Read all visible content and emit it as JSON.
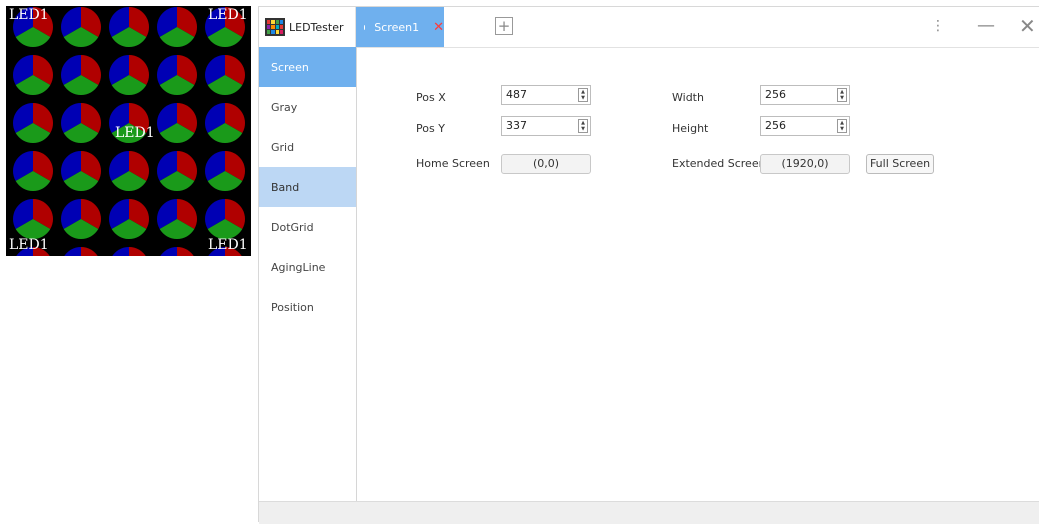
{
  "preview": {
    "labels": [
      "LED1",
      "LED1",
      "LED1",
      "LED1",
      "LED1"
    ],
    "colors": {
      "red": "#b00000",
      "blue": "#0000b4",
      "green": "#1a9a1a",
      "background": "#000000"
    }
  },
  "app": {
    "title": "LEDTester",
    "logo_icon": "led-grid-logo-icon",
    "tabs": [
      {
        "label": "Screen1",
        "close_icon": "close-icon"
      }
    ],
    "add_tab_icon": "plus-icon",
    "window_controls": {
      "more": "more-vertical-icon",
      "minimize": "minimize-icon",
      "close": "close-icon"
    }
  },
  "sidebar": {
    "items": [
      {
        "label": "Screen"
      },
      {
        "label": "Gray"
      },
      {
        "label": "Grid"
      },
      {
        "label": "Band"
      },
      {
        "label": "DotGrid"
      },
      {
        "label": "AgingLine"
      },
      {
        "label": "Position"
      }
    ]
  },
  "form": {
    "pos_x": {
      "label": "Pos X",
      "value": "487"
    },
    "pos_y": {
      "label": "Pos Y",
      "value": "337"
    },
    "width": {
      "label": "Width",
      "value": "256"
    },
    "height": {
      "label": "Height",
      "value": "256"
    },
    "home_screen": {
      "label": "Home Screen",
      "value": "(0,0)"
    },
    "extended_screen": {
      "label": "Extended Screen",
      "value": "(1920,0)"
    },
    "full_screen_button": "Full Screen"
  },
  "accent_colors": {
    "selected_tab": "#6fb0ee",
    "selected_nav": "#6fb0ee",
    "highlight_nav": "#bcd7f4",
    "close_x": "#ff3b3b"
  }
}
